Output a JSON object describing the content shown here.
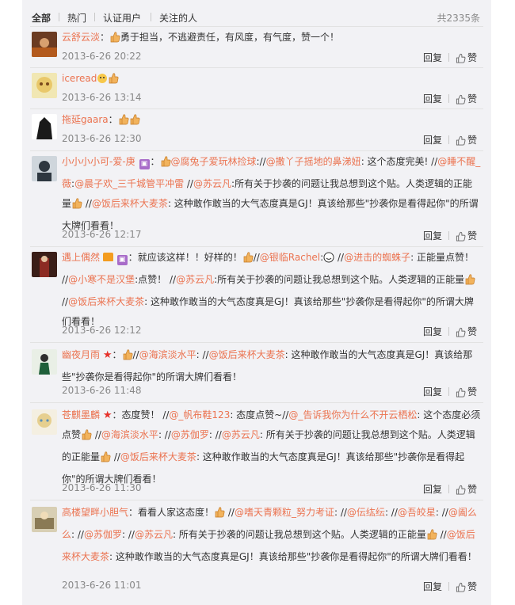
{
  "tabs": [
    {
      "label": "全部",
      "active": true
    },
    {
      "label": "热门"
    },
    {
      "label": "认证用户"
    },
    {
      "label": "关注的人"
    }
  ],
  "total": "共2335条",
  "reply_label": "回复",
  "like_label": "赞",
  "comments": [
    {
      "user": "云舒云淡",
      "separator": "：",
      "text": "勇于担当，不逃避责任，有风度，有气度，赞一个！",
      "time": "2013-6-26 20:22"
    },
    {
      "user": "iceread",
      "separator": "",
      "time": "2013-6-26 13:14"
    },
    {
      "user": "拖延gaara",
      "separator": "：",
      "time": "2013-6-26 12:30"
    },
    {
      "user": "小小小小可-爱-庚",
      "separator": "：",
      "p1": "@腐兔子爱玩林捡球",
      "p2": "://",
      "p3": "@撒丫子摇地的鼻涕妞",
      "p4": ": 这个态度完美! //",
      "p5": "@睡不醒_薇",
      "p6": ":",
      "p7": "@晨子欢_三千城管平冲雷",
      "p8": " //",
      "p9": "@苏云凡",
      "p10": ":所有关于抄袭的问题让我总想到这个贴。人类逻辑的正能量",
      "p11": " //",
      "p12": "@饭后来杯大麦茶",
      "p13": ": 这种敢作敢当的大气态度真是GJ！真该给那些\"抄袭你是看得起你\"的所谓大牌们看看！",
      "time": "2013-6-26 12:17"
    },
    {
      "user": "遇上偶然",
      "separator": "：",
      "p1": "就应该这样！！好样的！",
      "p2": "//",
      "p3": "@银临Rachel",
      "p4": ":",
      "p5": " //",
      "p6": "@进击的蜘蛛子",
      "p7": ": 正能量点赞！ //",
      "p8": "@小寒不是汉堡",
      "p9": ":点赞！ //",
      "p10": "@苏云凡",
      "p11": ":所有关于抄袭的问题让我总想到这个贴。人类逻辑的正能量",
      "p12": " //",
      "p13": "@饭后来杯大麦茶",
      "p14": ": 这种敢作敢当的大气态度真是GJ！真该给那些\"抄袭你是看得起你\"的所谓大牌们看看！",
      "time": "2013-6-26 12:12"
    },
    {
      "user": "幽夜月雨",
      "separator": "：",
      "p1": "//",
      "p2": "@海滨淡水平",
      "p3": ": //",
      "p4": "@饭后来杯大麦茶",
      "p5": ": 这种敢作敢当的大气态度真是GJ！真该给那些\"抄袭你是看得起你\"的所谓大牌们看看！",
      "time": "2013-6-26 11:48"
    },
    {
      "user": "苍麒墨麟",
      "separator": "：",
      "p1": "态度赞！ //",
      "p2": "@_帆布鞋123",
      "p3": ": 态度点赞~//",
      "p4": "@_告诉我你为什么不开云栖松",
      "p5": ": 这个态度必须点赞",
      "p6": " //",
      "p7": "@海滨淡水平",
      "p8": ": //",
      "p9": "@苏伽罗",
      "p10": ": //",
      "p11": "@苏云凡",
      "p12": ": 所有关于抄袭的问题让我总想到这个贴。人类逻辑的正能量",
      "p13": " //",
      "p14": "@饭后来杯大麦茶",
      "p15": ": 这种敢作敢当的大气态度真是GJ！真该给那些\"抄袭你是看得起你\"的所谓大牌们看看！",
      "time": "2013-6-26 11:30"
    },
    {
      "user": "高楼望畔小胆气",
      "separator": "：",
      "p1": "看看人家这态度！",
      "p2": " //",
      "p3": "@嗜天青颗粒_努力考证",
      "p4": ": //",
      "p5": "@伝纮纭",
      "p6": ": //",
      "p7": "@吾皎星",
      "p8": ": //",
      "p9": "@阖么么",
      "p10": ": //",
      "p11": "@苏伽罗",
      "p12": ": //",
      "p13": "@苏云凡",
      "p14": ": 所有关于抄袭的问题让我总想到这个贴。人类逻辑的正能量",
      "p15": " //",
      "p16": "@饭后来杯大麦茶",
      "p17": ": 这种敢作敢当的大气态度真是GJ！真该给那些\"抄袭你是看得起你\"的所谓大牌们看看！",
      "time": "2013-6-26 11:01"
    }
  ]
}
